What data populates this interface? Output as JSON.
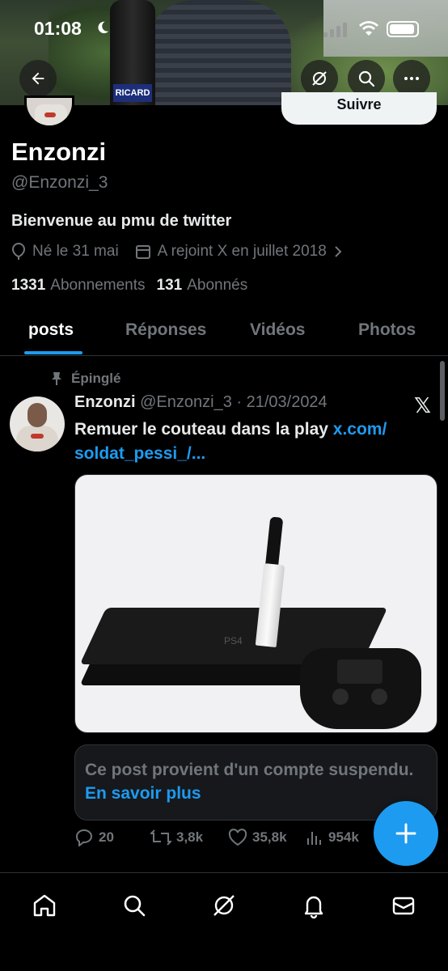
{
  "status_bar": {
    "time": "01:08"
  },
  "banner": {
    "bottle_label": "RICARD"
  },
  "profile": {
    "follow_button": "Suivre",
    "display_name": "Enzonzi",
    "handle": "@Enzonzi_3",
    "bio": "Bienvenue au pmu de twitter",
    "birthday": "Né le 31 mai",
    "joined": "A rejoint X en juillet 2018",
    "following_count": "1331",
    "following_label": "Abonnements",
    "followers_count": "131",
    "followers_label": "Abonnés"
  },
  "tabs": [
    {
      "label": "posts",
      "active": true
    },
    {
      "label": "Réponses",
      "active": false
    },
    {
      "label": "Vidéos",
      "active": false
    },
    {
      "label": "Photos",
      "active": false
    }
  ],
  "post": {
    "pinned_label": "Épinglé",
    "author_name": "Enzonzi",
    "author_meta": "@Enzonzi_3 · 21/03/2024",
    "text": "Remuer le couteau dans la play ",
    "link_text": "x.com/ soldat_pessi_/...",
    "media_console_label": "PS4",
    "suspended_text": "Ce post provient d'un compte suspendu. ",
    "suspended_link": "En savoir plus",
    "stats": {
      "replies": "20",
      "reposts": "3,8k",
      "likes": "35,8k",
      "views": "954k"
    }
  },
  "colors": {
    "accent": "#1d9bf0",
    "background": "#000000",
    "muted": "#71767b"
  }
}
